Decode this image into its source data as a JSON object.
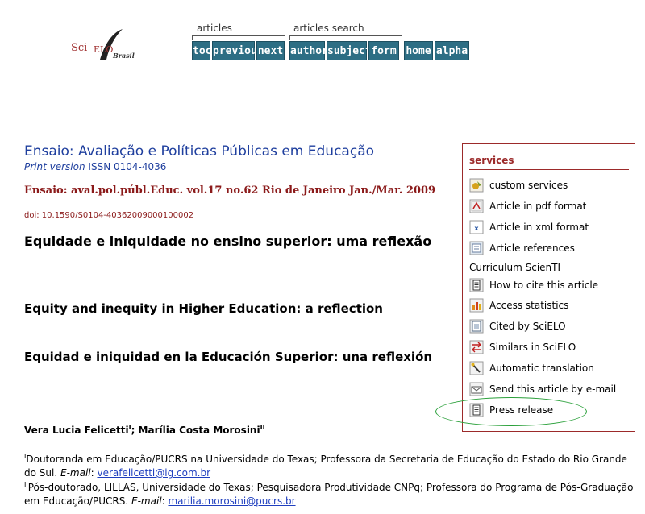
{
  "logo": {
    "sci": "Sci",
    "elo": "ELO",
    "brasil": "Brasil"
  },
  "nav": {
    "articles_label": "articles",
    "articles_search_label": "articles search",
    "buttons": {
      "toc": "toc",
      "previous": "previous",
      "next": "next",
      "author": "author",
      "subject": "subject",
      "form": "form",
      "home": "home",
      "alpha": "alpha"
    }
  },
  "journal": {
    "title": "Ensaio: Avaliação e Políticas Públicas em Educação",
    "print_version_label": "Print version",
    "issn": "ISSN 0104-4036",
    "issue_line": "Ensaio: aval.pol.públ.Educ. vol.17 no.62 Rio de Janeiro Jan./Mar. 2009",
    "doi": "doi: 10.1590/S0104-40362009000100002"
  },
  "article": {
    "title_pt": "Equidade e iniquidade no ensino superior: uma reflexão",
    "title_en": "Equity and inequity in Higher Education: a reflection",
    "title_es": "Equidad e iniquidad en la Educación Superior: una reflexión",
    "authors": [
      {
        "name": "Vera Lucia Felicetti",
        "sup": "I"
      },
      {
        "name": "Marília Costa Morosini",
        "sup": "II"
      }
    ],
    "author_separator": "; ",
    "affiliations": [
      {
        "sup": "I",
        "text": "Doutoranda em Educação/PUCRS na Universidade do Texas; Professora da Secretaria de Educação do Estado do Rio Grande do Sul.",
        "email_label": "E-mail",
        "email": "verafelicetti@ig.com.br"
      },
      {
        "sup": "II",
        "text": "Pós-doutorado, LILLAS, Universidade do Texas; Pesquisadora Produtividade CNPq; Professora do Programa de Pós-Graduação em Educação/PUCRS.",
        "email_label": "E-mail",
        "email": "marilia.morosini@pucrs.br"
      }
    ]
  },
  "services": {
    "title": "services",
    "items": [
      {
        "label": "custom services",
        "icon": "custom-services-icon"
      },
      {
        "label": "Article in pdf format",
        "icon": "pdf-icon"
      },
      {
        "label": "Article in xml format",
        "icon": "xml-icon"
      },
      {
        "label": "Article references",
        "icon": "references-icon"
      },
      {
        "label": "Curriculum ScienTI",
        "icon": ""
      },
      {
        "label": "How to cite this article",
        "icon": "cite-icon"
      },
      {
        "label": "Access statistics",
        "icon": "statistics-icon"
      },
      {
        "label": "Cited by SciELO",
        "icon": "cited-icon"
      },
      {
        "label": "Similars in SciELO",
        "icon": "similars-icon"
      },
      {
        "label": "Automatic translation",
        "icon": "translation-icon"
      },
      {
        "label": "Send this article by e-mail",
        "icon": "email-icon"
      },
      {
        "label": "Press release",
        "icon": "press-release-icon"
      }
    ]
  },
  "colors": {
    "nav_button": "#2d6e84",
    "journal_blue": "#1f3f9e",
    "issue_red": "#8b1a1a",
    "services_border": "#9c2a2a",
    "highlight_green": "#2aa03a"
  }
}
